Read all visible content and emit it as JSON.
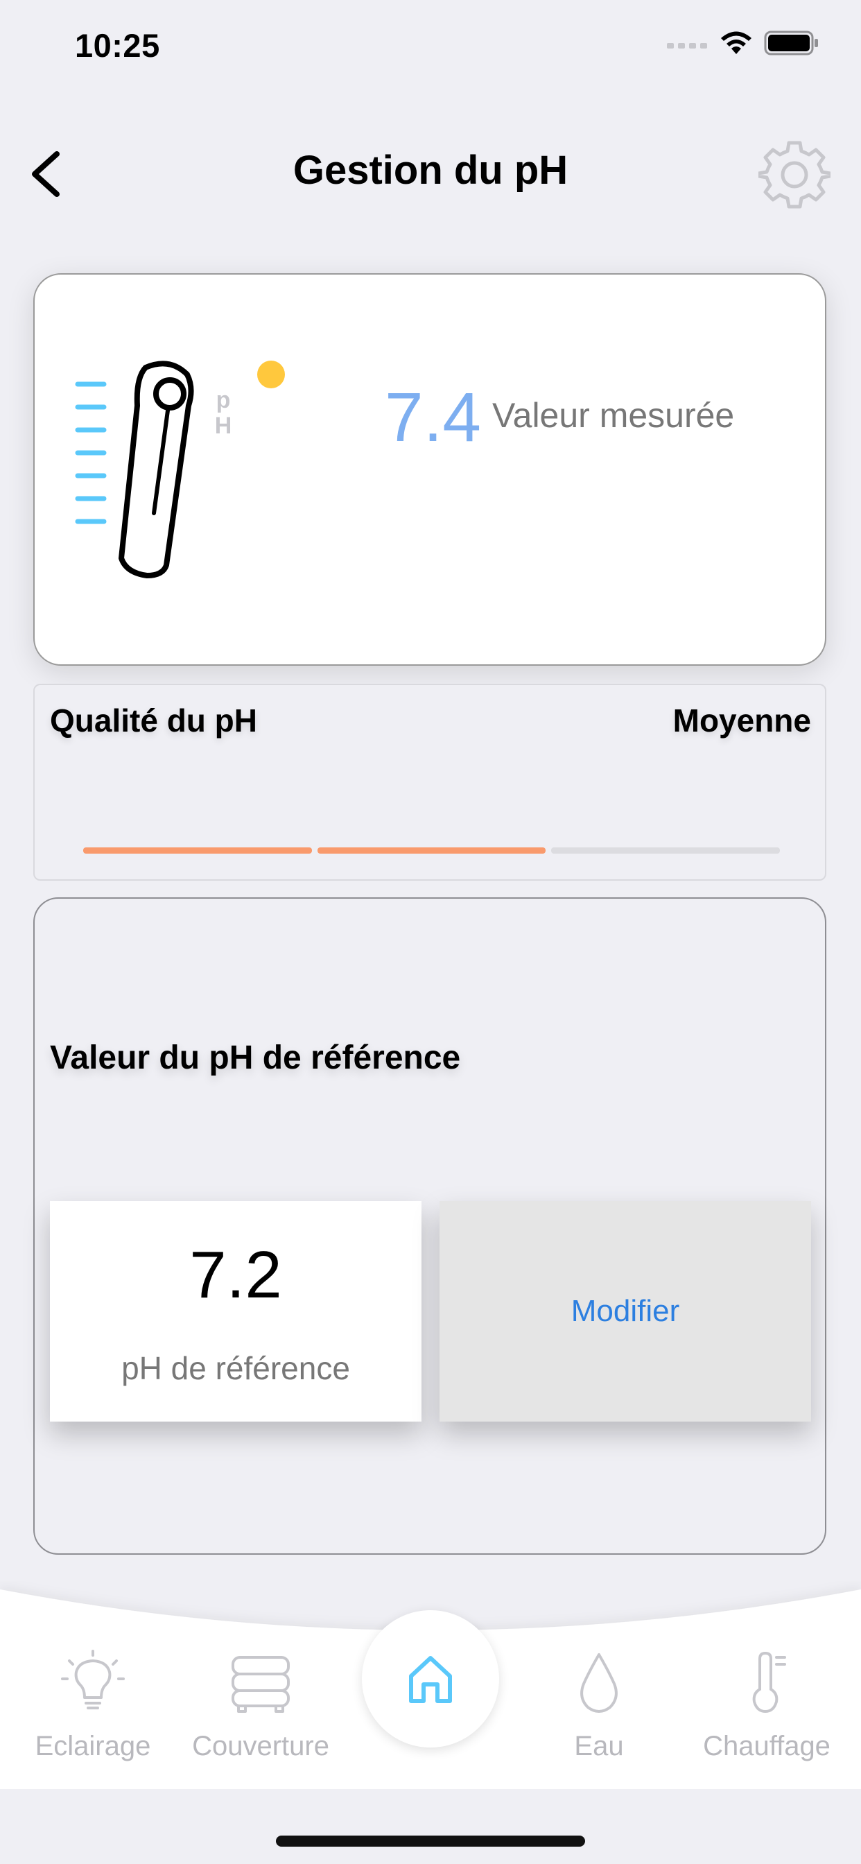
{
  "status_bar": {
    "time": "10:25"
  },
  "nav": {
    "title": "Gestion du pH"
  },
  "measure": {
    "value": "7.4",
    "label": "Valeur mesurée",
    "illustration_label_p": "p",
    "illustration_label_h": "H"
  },
  "quality": {
    "title": "Qualité du pH",
    "value": "Moyenne",
    "level_segments_filled": 2,
    "level_segments_total": 3
  },
  "reference": {
    "title": "Valeur du pH de référence",
    "value": "7.2",
    "label": "pH de référence",
    "modify_label": "Modifier"
  },
  "tabs": [
    {
      "label": "Eclairage",
      "icon": "lightbulb-icon"
    },
    {
      "label": "Couverture",
      "icon": "pool-cover-icon"
    },
    {
      "label": "",
      "icon": "home-icon"
    },
    {
      "label": "Eau",
      "icon": "water-drop-icon"
    },
    {
      "label": "Chauffage",
      "icon": "thermometer-icon"
    }
  ],
  "colors": {
    "accent_blue": "#2C7FE0",
    "value_blue": "#7DAEF0",
    "indicator_yellow": "#FFC83D",
    "quality_orange": "#F99A6C",
    "home_icon_blue": "#5AC8FA",
    "inactive_gray": "#B8B8BD"
  }
}
